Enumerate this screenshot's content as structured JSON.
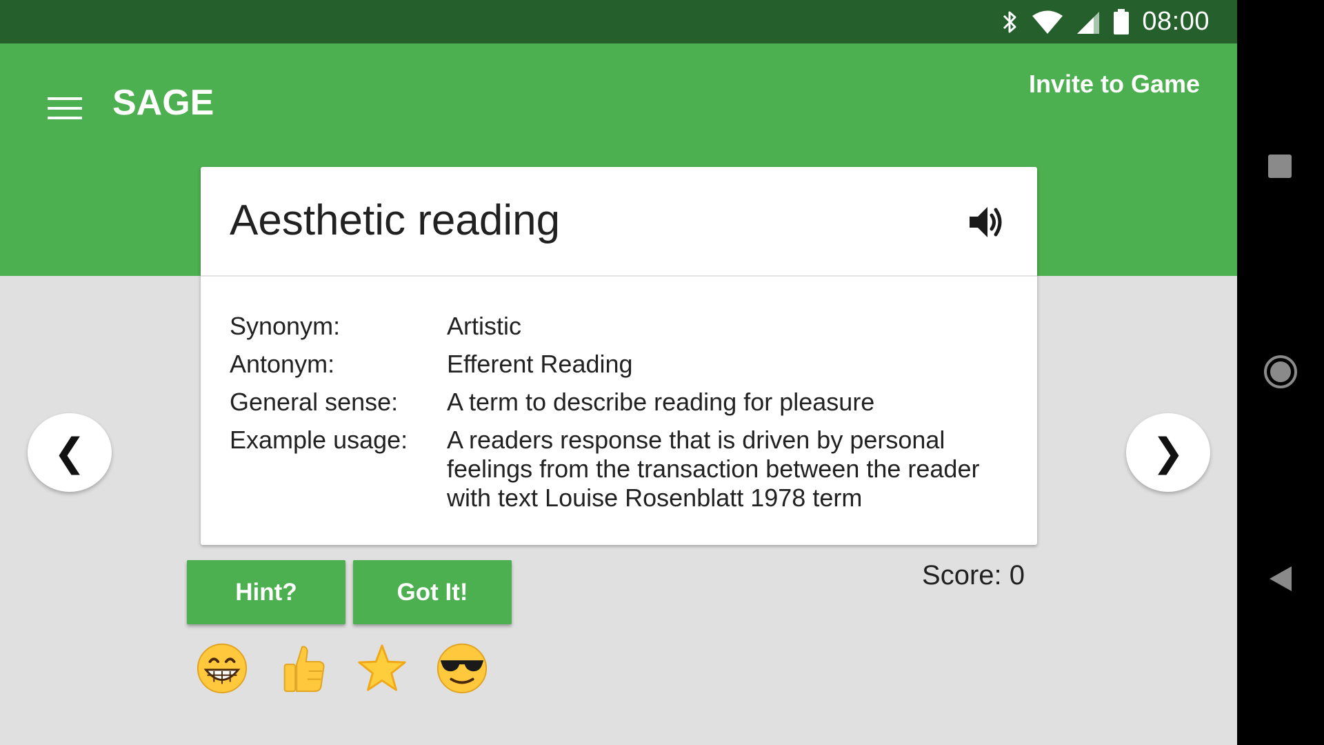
{
  "status_bar": {
    "time": "08:00",
    "icons": [
      "bluetooth-icon",
      "wifi-icon",
      "cell-signal-icon",
      "battery-icon"
    ]
  },
  "app_bar": {
    "menu_icon": "hamburger-menu-icon",
    "title": "SAGE",
    "invite_label": "Invite to Game",
    "color": "#4caf50"
  },
  "card": {
    "term": "Aesthetic reading",
    "speaker_icon": "speaker-icon",
    "rows": [
      {
        "label": "Synonym:",
        "value": "Artistic"
      },
      {
        "label": "Antonym:",
        "value": "Efferent Reading"
      },
      {
        "label": "General sense:",
        "value": "A term to describe reading for pleasure"
      },
      {
        "label": "Example usage:",
        "value": "A readers response that is driven by personal feelings from the transaction between the reader with text Louise Rosenblatt 1978 term"
      }
    ]
  },
  "navigation": {
    "prev_symbol": "❮",
    "next_symbol": "❯"
  },
  "actions": {
    "hint_label": "Hint?",
    "gotit_label": "Got It!"
  },
  "score": {
    "text": "Score: 0"
  },
  "reactions": [
    "grinning-face-emoji",
    "thumbs-up-emoji",
    "star-emoji",
    "sunglasses-face-emoji"
  ],
  "system_nav": [
    "recents-square-icon",
    "home-circle-icon",
    "back-triangle-icon"
  ],
  "colors": {
    "primary": "#4caf50",
    "status_bar": "#25602c",
    "background": "#e0e0e0"
  }
}
